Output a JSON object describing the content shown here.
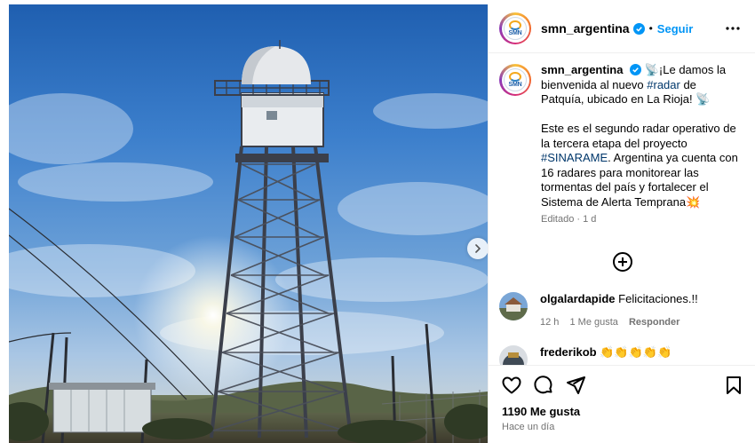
{
  "post": {
    "author": "smn_argentina",
    "follow_label": "Seguir",
    "dot": "•",
    "caption": {
      "intro_prefix": "📡¡Le damos la bienvenida al nuevo ",
      "hashtag_radar": "#radar",
      "intro_suffix": " de Patquía, ubicado en La Rioja! 📡",
      "para2_prefix": "Este es el segundo radar operativo de la tercera etapa del proyecto ",
      "hashtag_sinarame": "#SINARAME",
      "para2_suffix": ". Argentina ya cuenta con 16 radares para monitorear las tormentas del país y fortalecer el Sistema de Alerta Temprana💥",
      "meta": "Editado · 1 d"
    },
    "avatar_logo_text": "SMN"
  },
  "comments": [
    {
      "user": "olgalardapide",
      "text": "Felicitaciones.!!",
      "time": "12 h",
      "likes": "1 Me gusta",
      "reply": "Responder"
    },
    {
      "user": "frederikob",
      "text": "👏👏👏👏👏"
    }
  ],
  "footer": {
    "likes": "1190 Me gusta",
    "time": "Hace un día"
  },
  "icons": {
    "heart": "heart-icon",
    "comment": "comment-icon",
    "share": "share-icon",
    "save": "bookmark-icon",
    "more": "more-options-icon",
    "next": "chevron-right-icon",
    "add": "add-comment-icon"
  },
  "colors": {
    "link": "#0095f6",
    "hashtag": "#00376b",
    "muted": "#737373"
  }
}
